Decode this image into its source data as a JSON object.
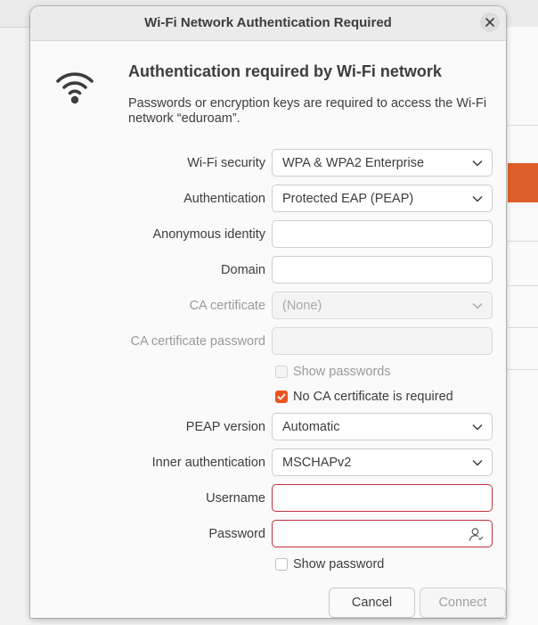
{
  "dialog": {
    "title": "Wi-Fi Network Authentication Required",
    "heading": "Authentication required by Wi-Fi network",
    "description": "Passwords or encryption keys are required to access the Wi-Fi network “eduroam”.",
    "icons": {
      "wifi": "wifi-icon",
      "close": "close-icon",
      "chevron": "chevron-down-icon",
      "user": "user-icon"
    },
    "accent_color": "#e95420",
    "error_color": "#c0303a"
  },
  "form": {
    "wifi_security": {
      "label": "Wi-Fi security",
      "value": "WPA & WPA2 Enterprise"
    },
    "authentication": {
      "label": "Authentication",
      "value": "Protected EAP (PEAP)"
    },
    "anonymous_identity": {
      "label": "Anonymous identity",
      "value": ""
    },
    "domain": {
      "label": "Domain",
      "value": ""
    },
    "ca_certificate": {
      "label": "CA certificate",
      "value": "(None)"
    },
    "ca_certificate_password": {
      "label": "CA certificate password",
      "value": ""
    },
    "show_passwords": {
      "label": "Show passwords",
      "checked": false
    },
    "no_ca_required": {
      "label": "No CA certificate is required",
      "checked": true
    },
    "peap_version": {
      "label": "PEAP version",
      "value": "Automatic"
    },
    "inner_authentication": {
      "label": "Inner authentication",
      "value": "MSCHAPv2"
    },
    "username": {
      "label": "Username",
      "value": ""
    },
    "password": {
      "label": "Password",
      "value": ""
    },
    "show_password": {
      "label": "Show password",
      "checked": false
    }
  },
  "buttons": {
    "cancel": "Cancel",
    "connect": "Connect"
  }
}
